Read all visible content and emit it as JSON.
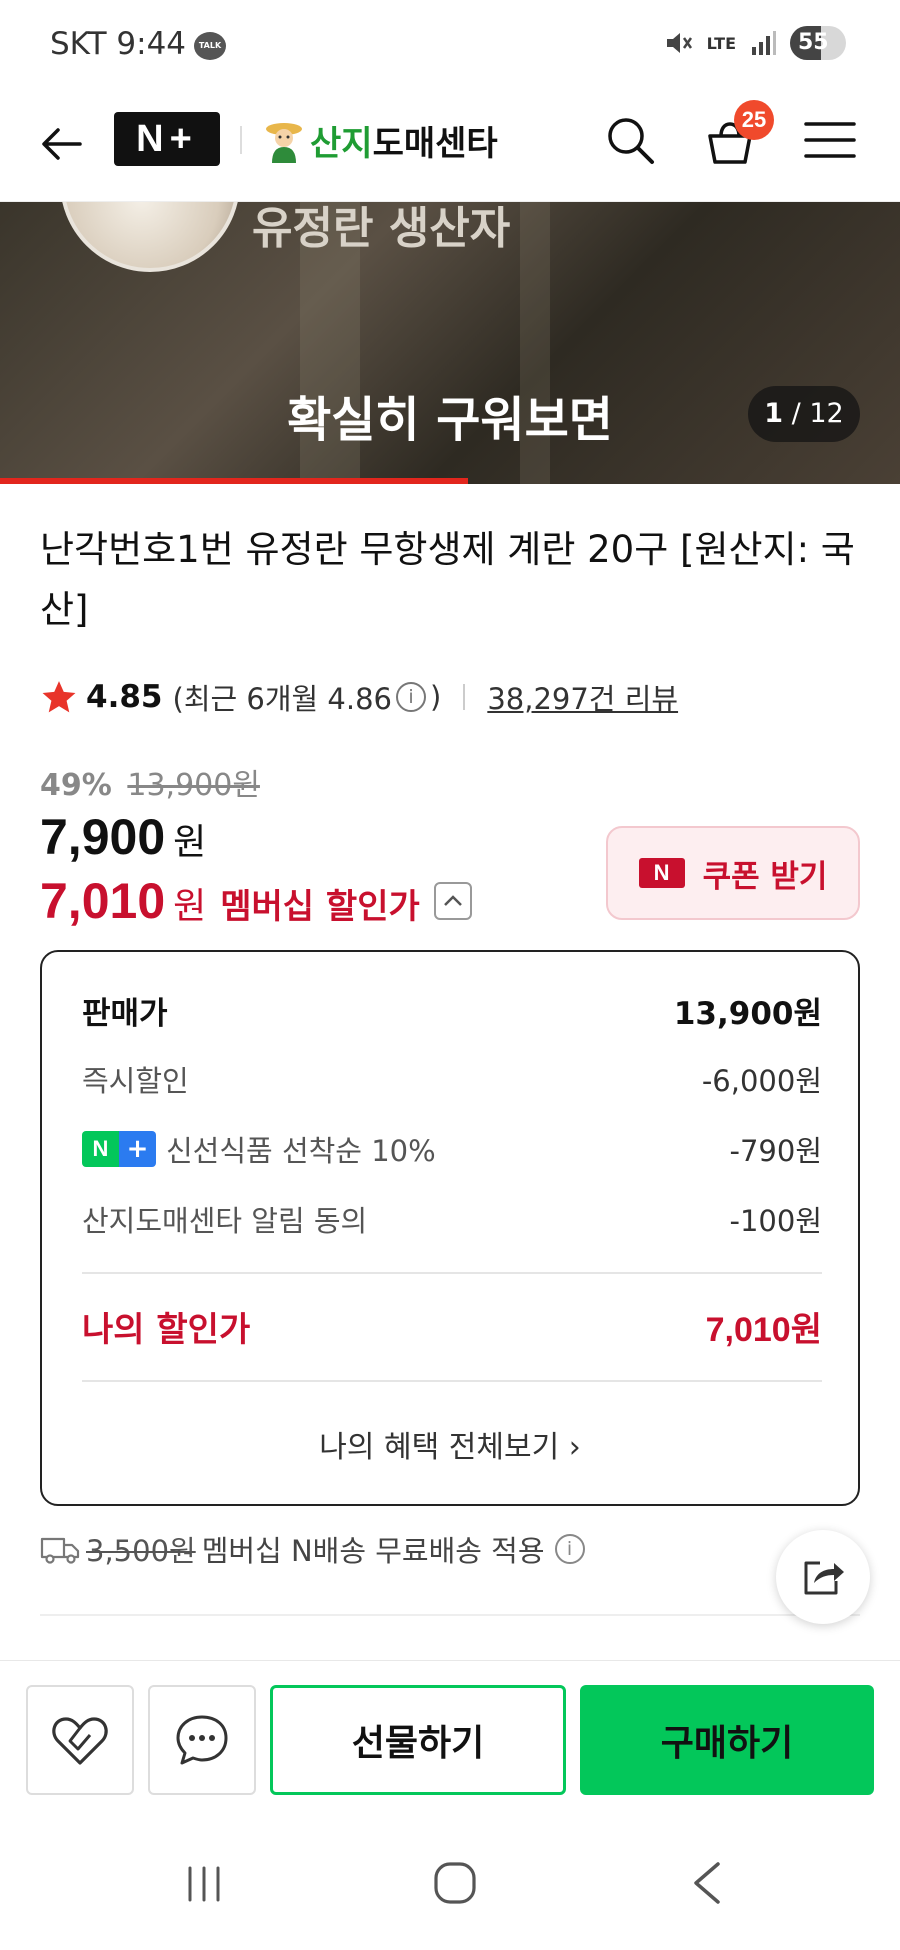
{
  "status": {
    "carrier": "SKT",
    "time": "9:44",
    "talk": "TALK",
    "network": "LTE",
    "battery": "55",
    "battery_level": 0.55
  },
  "header": {
    "logo": "N+",
    "store_prefix": "산지",
    "store_suffix": "도매센타",
    "cart_count": "25"
  },
  "banner": {
    "producer": "유정란 생산자",
    "caption": "확실히 구워보면",
    "counter_current": "1",
    "counter_sep": "/",
    "counter_total": "12",
    "progress": 0.52
  },
  "product": {
    "title": "난각번호1번 유정란 무항생제 계란 20구 [원산지: 국산]",
    "rating": "4.85",
    "recent_open": "(최근 6개월 4.86",
    "recent_close": ")",
    "info_glyph": "i",
    "reviews": "38,297건 리뷰",
    "discount_pct": "49%",
    "original_price": "13,900원",
    "price": "7,900",
    "won": "원",
    "member_price": "7,010",
    "member_label": "멤버십 할인가"
  },
  "coupon": {
    "badge": "N",
    "label": "쿠폰 받기"
  },
  "breakdown": {
    "rows": [
      {
        "label": "판매가",
        "value": "13,900원"
      },
      {
        "label": "즉시할인",
        "value": "-6,000원"
      },
      {
        "label": "신선식품 선착순 10%",
        "value": "-790원"
      },
      {
        "label": "산지도매센타 알림 동의",
        "value": "-100원"
      }
    ],
    "my_label": "나의 할인가",
    "my_value": "7,010원",
    "benefits_link": "나의 혜택 전체보기 ›"
  },
  "shipping": {
    "original": "3,500원",
    "text": "멤버십 N배송 무료배송 적용"
  },
  "bottom": {
    "gift": "선물하기",
    "buy": "구매하기"
  },
  "colors": {
    "naver_green": "#03c75a",
    "accent_red": "#c8102e",
    "badge_orange": "#f04a2c"
  }
}
